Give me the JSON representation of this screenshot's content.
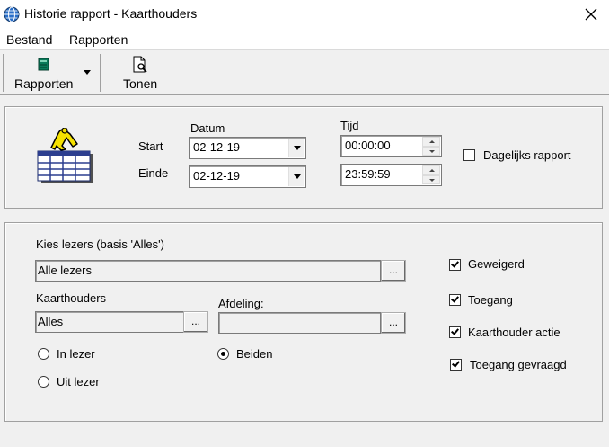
{
  "window": {
    "title": "Historie rapport - Kaarthouders",
    "close_glyph": "✕"
  },
  "menu": {
    "items": [
      "Bestand",
      "Rapporten"
    ]
  },
  "toolbar": {
    "rapporten_label": "Rapporten",
    "tonen_label": "Tonen"
  },
  "period": {
    "datum_label": "Datum",
    "tijd_label": "Tijd",
    "start_label": "Start",
    "einde_label": "Einde",
    "start_date": "02-12-19",
    "end_date": "02-12-19",
    "start_time": "00:00:00",
    "end_time": "23:59:59",
    "daily_label": "Dagelijks rapport",
    "daily_checked": false
  },
  "filters": {
    "readers_label": "Kies lezers (basis 'Alles')",
    "readers_value": "Alle lezers",
    "cardholders_label": "Kaarthouders",
    "cardholders_value": "Alles",
    "department_label": "Afdeling:",
    "department_value": "",
    "dots": "...",
    "radios": {
      "in_reader": "In lezer",
      "out_reader": "Uit lezer",
      "both": "Beiden",
      "selected": "both"
    },
    "checks": [
      {
        "label": "Geweigerd",
        "checked": true
      },
      {
        "label": "Toegang",
        "checked": true
      },
      {
        "label": "Kaarthouder actie",
        "checked": true
      },
      {
        "label": "Toegang gevraagd",
        "checked": true
      }
    ]
  },
  "icons": {
    "app": "globe-icon",
    "rapporten": "report-book-icon",
    "tonen": "page-preview-icon",
    "report_graphic": "report-person-table-icon"
  }
}
